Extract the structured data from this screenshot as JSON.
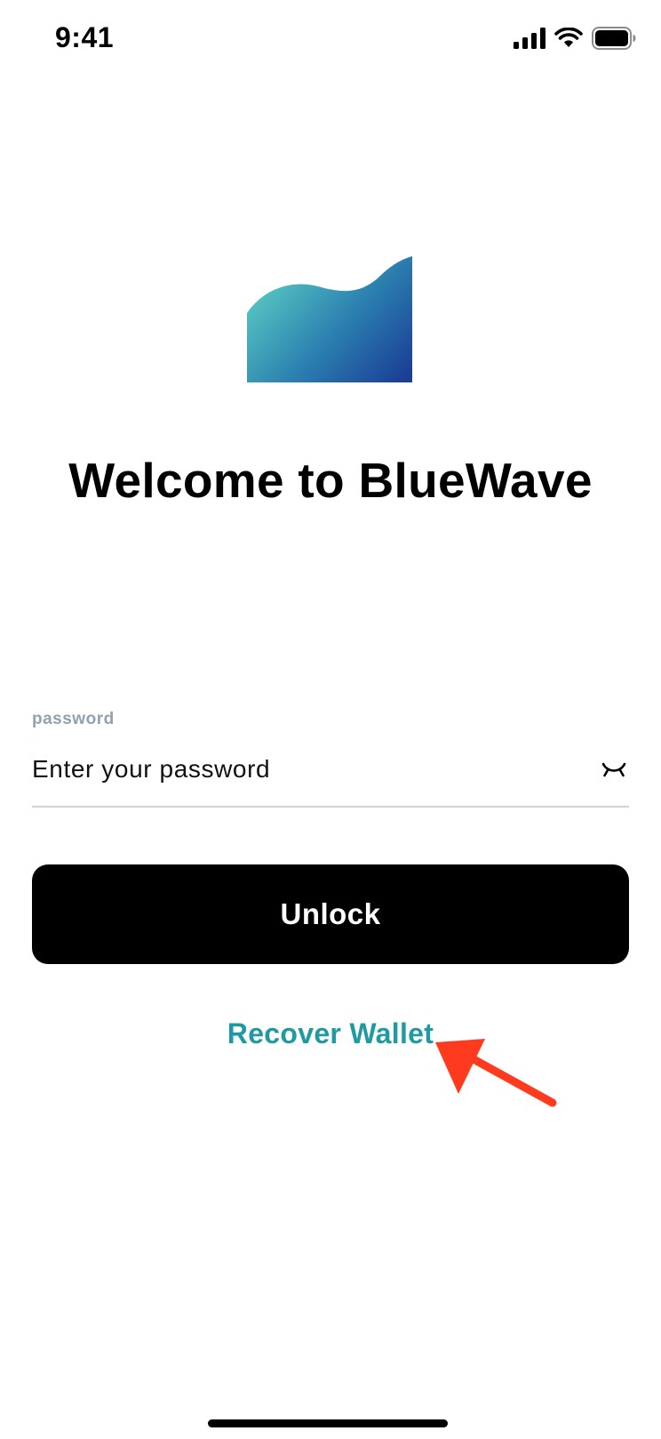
{
  "status_bar": {
    "time": "9:41",
    "icons": [
      "cellular-signal-icon",
      "wifi-icon",
      "battery-icon"
    ]
  },
  "logo": {
    "icon": "bluewave-logo",
    "gradient": [
      "#5ccfc4",
      "#2b7fb0",
      "#1b3f96"
    ]
  },
  "title": "Welcome to BlueWave",
  "password_field": {
    "label": "password",
    "placeholder": "Enter your password",
    "value": "",
    "toggle_icon": "eye-closed-icon"
  },
  "unlock_button": {
    "label": "Unlock"
  },
  "recover_link": {
    "label": "Recover Wallet"
  },
  "annotation": {
    "icon": "red-arrow-icon",
    "color": "#ff3b1f"
  },
  "colors": {
    "accent": "#1f9aa0",
    "label": "#8fa1b3",
    "button": "#000000",
    "underline": "#c9d6df"
  }
}
